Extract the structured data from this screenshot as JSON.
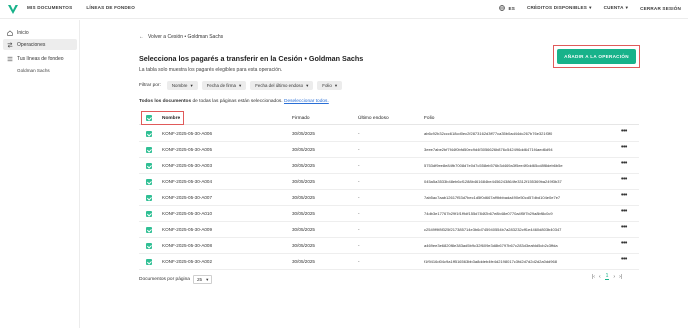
{
  "topbar": {
    "nav_left": [
      "MIS DOCUMENTOS",
      "LÍNEAS DE FONDEO"
    ],
    "lang": "ES",
    "credits": "CRÉDITOS DISPONIBLES",
    "account": "CUENTA",
    "logout": "CERRAR SESIÓN"
  },
  "sidebar": {
    "items": [
      {
        "label": "Inicio",
        "icon": "home-icon"
      },
      {
        "label": "Operaciones",
        "icon": "swap-icon"
      },
      {
        "label": "Tus líneas de fondeo",
        "icon": "list-icon"
      }
    ],
    "sub_item": "Goldman Sachs"
  },
  "main": {
    "back": "Volver a Cesión • Goldman Sachs",
    "title": "Selecciona los pagarés a transferir en la Cesión • Goldman Sachs",
    "subtitle": "La tabla solo muestra los pagarés elegibles para esta operación.",
    "add_button": "AÑADIR A LA OPERACIÓN",
    "filter_label": "Filtrar por:",
    "filters": [
      "Nombre",
      "Fecha de firma",
      "Fecha del último endoso",
      "Folio"
    ],
    "selection_bold": "Todos los documentos",
    "selection_text": " de todas las páginas están seleccionados.",
    "deselect": "Deseleccionar todos."
  },
  "table": {
    "headers": [
      "Nombre",
      "Firmado",
      "Último endoso",
      "Folio"
    ],
    "rows": [
      {
        "name": "KONF-2025-05-30-A006",
        "signed": "30/05/2025",
        "last": "-",
        "folio": "ab6c92b32ccc618cd0ec2f2873162d3ff77ca35b0ad44dc267b76e321f3f0"
      },
      {
        "name": "KONF-2025-05-30-A005",
        "signed": "30/05/2025",
        "last": "-",
        "folio": "3eee7abe2bf7f44f0bfd50ec9d4f3056626b876c542496dd6471f4aed6d94"
      },
      {
        "name": "KONF-2025-05-30-A003",
        "signed": "30/05/2025",
        "last": "-",
        "folio": "5753df9ee8e84fb7008d7e0d7c558eb576b3d469a3f5ee4f0dd65cd8f8deb6b5e"
      },
      {
        "name": "KONF-2025-05-30-A004",
        "signed": "30/05/2025",
        "last": "-",
        "folio": "045a5a3533b48eb6cf1288b461684be4456243864fe3312f155369ba249f3b37"
      },
      {
        "name": "KONF-2025-05-30-A007",
        "signed": "30/05/2025",
        "last": "-",
        "folio": "7ab5ac7aab12617f53d7bec1d5f0d667af9bbbada490e50cd57dbd104e0e7e7"
      },
      {
        "name": "KONF-2025-05-30-A010",
        "signed": "30/05/2025",
        "last": "-",
        "folio": "74db3e17767b29f1f1f9df155d784f2b67e8b48e0770a4f5f7b29a8bf8c0c9"
      },
      {
        "name": "KONF-2025-05-30-A009",
        "signed": "30/05/2025",
        "last": "-",
        "folio": "c2549f9f8f325f217385714e3b6d745940554b7a283232cff1e4460d803b40347"
      },
      {
        "name": "KONF-2025-05-30-A008",
        "signed": "30/05/2025",
        "last": "-",
        "folio": "a469ee3e6820f8e383ad5b9c32f609e3d8b6797b67c283d3eafdd5cb2c3ffda"
      },
      {
        "name": "KONF-2025-05-30-A002",
        "signed": "30/05/2025",
        "last": "-",
        "folio": "f1f9416d04c9a1ff516563bb3a8ddeb4fe4d2198017c3fd2d7d2d2d2a0dd968"
      }
    ]
  },
  "pager": {
    "per_page_label": "Documentos por página",
    "per_page": "25",
    "page": "1"
  },
  "colors": {
    "accent": "#18b28a",
    "highlight": "#e05a5a",
    "link": "#2a6fd6"
  }
}
